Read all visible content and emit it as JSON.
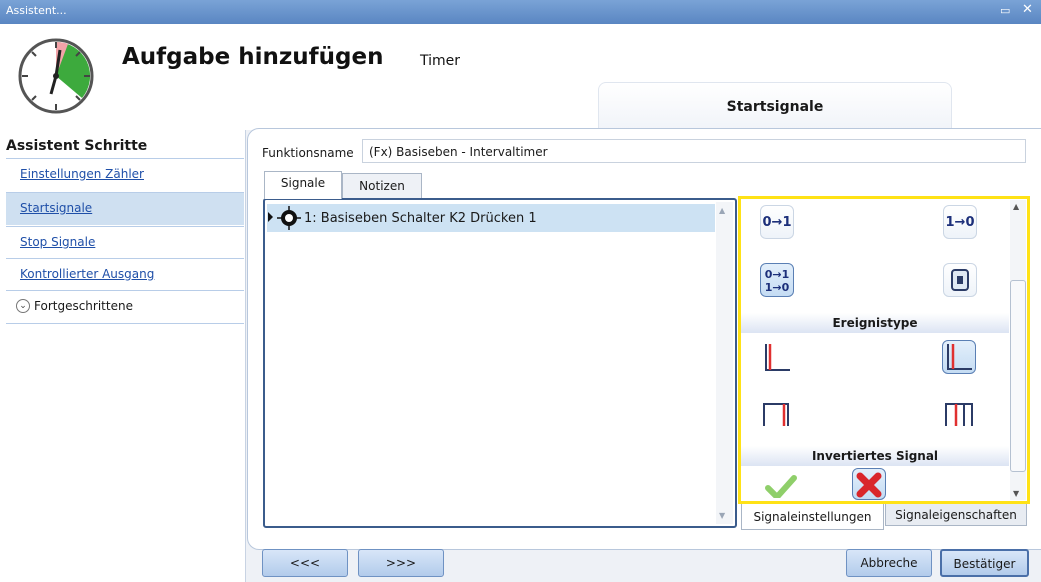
{
  "window": {
    "title": "Assistent..."
  },
  "header": {
    "title": "Aufgabe hinzufügen",
    "subtitle": "Timer",
    "current_step_tab": "Startsignale"
  },
  "sidebar": {
    "title": "Assistent Schritte",
    "items": [
      {
        "label": "Einstellungen Zähler",
        "active": false
      },
      {
        "label": "Startsignale",
        "active": true
      },
      {
        "label": "Stop Signale",
        "active": false
      },
      {
        "label": "Kontrollierter Ausgang",
        "active": false
      }
    ],
    "advanced_label": "Fortgeschrittene"
  },
  "form": {
    "function_name_label": "Funktionsname",
    "function_name_value": "(Fx) Basiseben - Intervaltimer"
  },
  "tabs": [
    {
      "label": "Signale",
      "selected": true
    },
    {
      "label": "Notizen",
      "selected": false
    }
  ],
  "signal_list": [
    {
      "label": "1: Basiseben Schalter K2 Drücken 1",
      "selected": true
    }
  ],
  "options_panel": {
    "section_event_type": "Ereignistype",
    "section_inverted": "Invertiertes Signal",
    "edge_buttons": [
      "0→1",
      "1→0"
    ],
    "bottom_tabs": [
      {
        "label": "Signaleinstellungen",
        "selected": true
      },
      {
        "label": "Signaleigenschaften",
        "selected": false
      }
    ]
  },
  "footer": {
    "prev_label": "<<<",
    "next_label": ">>>",
    "cancel_label": "Abbreche",
    "confirm_label": "Bestätiger"
  },
  "colors": {
    "highlight_border": "#ffe216",
    "selection": "#cde2f3",
    "link": "#1f4fa8"
  }
}
